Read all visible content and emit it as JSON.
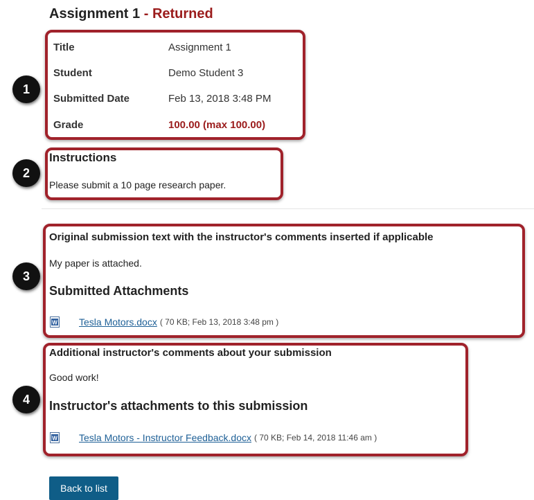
{
  "header": {
    "title": "Assignment 1",
    "separator": " - ",
    "status": "Returned"
  },
  "markers": [
    "1",
    "2",
    "3",
    "4"
  ],
  "info": {
    "rows": [
      {
        "label": "Title",
        "value": "Assignment 1"
      },
      {
        "label": "Student",
        "value": "Demo Student 3"
      },
      {
        "label": "Submitted Date",
        "value": "Feb 13, 2018 3:48 PM"
      },
      {
        "label": "Grade",
        "value": "100.00 (max 100.00)"
      }
    ]
  },
  "instructions": {
    "heading": "Instructions",
    "text": "Please submit a 10 page research paper."
  },
  "submission": {
    "heading": "Original submission text with the instructor's comments inserted if applicable",
    "text": "My paper is attached.",
    "attachments_heading": "Submitted Attachments",
    "attachment": {
      "name": "Tesla Motors.docx",
      "meta": "( 70 KB; Feb 13, 2018 3:48 pm )",
      "icon": "word-document-icon"
    }
  },
  "feedback": {
    "heading": "Additional instructor's comments about your submission",
    "text": "Good work!",
    "attachments_heading": "Instructor's attachments to this submission",
    "attachment": {
      "name": "Tesla Motors - Instructor Feedback.docx",
      "meta": "( 70 KB; Feb 14, 2018 11:46 am )",
      "icon": "word-document-icon"
    }
  },
  "actions": {
    "back_label": "Back to list"
  },
  "colors": {
    "accent_red": "#9b1c1c",
    "box_border": "#a0222b",
    "link": "#1d5f96",
    "button_bg": "#0f5d87"
  }
}
